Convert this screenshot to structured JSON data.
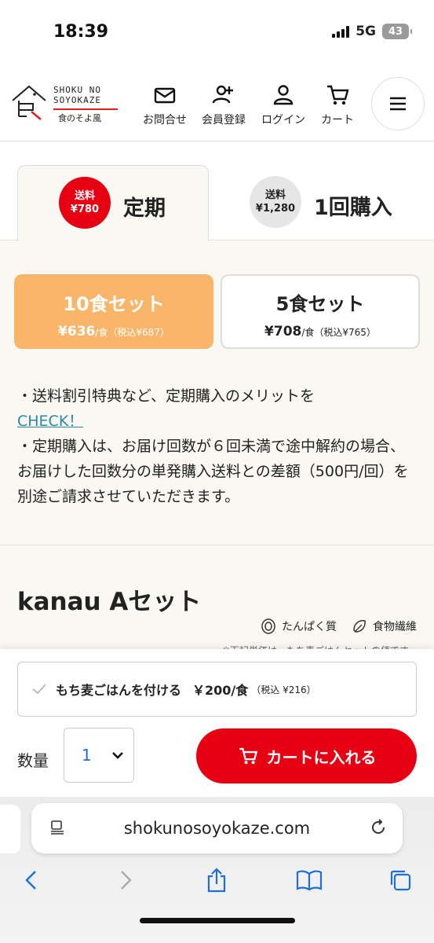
{
  "status": {
    "time": "18:39",
    "network": "5G",
    "battery": "43"
  },
  "header": {
    "logo_line1": "SHOKU NO",
    "logo_line2": "SOYOKAZE",
    "logo_jp": "食のそよ風",
    "nav": [
      {
        "label": "お問合せ",
        "icon": "mail-icon"
      },
      {
        "label": "会員登録",
        "icon": "add-user-icon"
      },
      {
        "label": "ログイン",
        "icon": "user-icon"
      },
      {
        "label": "カート",
        "icon": "cart-icon"
      }
    ],
    "menu_icon": "hamburger-icon"
  },
  "tabs": {
    "subscription": {
      "badge_line1": "送料",
      "badge_line2": "¥780",
      "label": "定期"
    },
    "single": {
      "badge_line1": "送料",
      "badge_line2": "¥1,280",
      "label": "1回購入"
    }
  },
  "sets": {
    "ten": {
      "title": "10食セット",
      "price": "¥636",
      "unit": "/食",
      "tax": "（税込¥687）"
    },
    "five": {
      "title": "5食セット",
      "price": "¥708",
      "unit": "/食",
      "tax": "（税込¥765）"
    }
  },
  "notes": {
    "line1": "・送料割引特典など、定期購入のメリットを",
    "check_link": "CHECK！",
    "line2": "・定期購入は、お届け回数が６回未満で途中解約の場合、 お届けした回数分の単発購入送料との差額（500円/回）を別途ご請求させていただきます。"
  },
  "product": {
    "title": "kanau Aセット",
    "legend": [
      "たんぱく質",
      "食物繊維"
    ],
    "partial_note": "※下記単価は、もち麦ごはんセットの値です"
  },
  "purchase": {
    "option_label": "もち麦ごはんを付ける",
    "option_price": "￥200/食",
    "option_tax": "（税込 ¥216）",
    "qty_label": "数量",
    "qty_value": "1",
    "cart_button": "カートに入れる"
  },
  "browser": {
    "url": "shokunosoyokaze.com"
  },
  "colors": {
    "accent_red": "#e60012",
    "set_orange": "#f9b66a",
    "link": "#2a8aa6"
  }
}
